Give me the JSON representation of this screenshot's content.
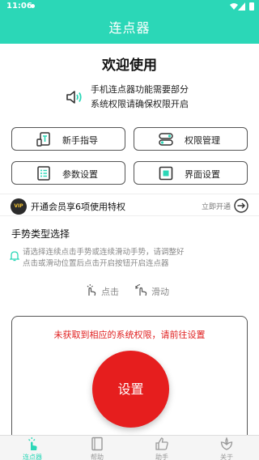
{
  "status_bar": {
    "time": "11:06"
  },
  "app_bar": {
    "title": "连点器"
  },
  "welcome": "欢迎使用",
  "notice": {
    "line1": "手机连点器功能需要部分",
    "line2": "系统权限请确保权限开启"
  },
  "buttons": {
    "guide": "新手指导",
    "permission": "权限管理",
    "params": "参数设置",
    "ui": "界面设置"
  },
  "vip": {
    "badge": "VIP",
    "text": "开通会员享6项使用特权",
    "action": "立即开通"
  },
  "gesture_section": {
    "title": "手势类型选择",
    "hint_line1": "请选择连续点击手势或连续滑动手势，请调整好",
    "hint_line2": "点击或滑动位置后点击开启按钮开启连点器",
    "click_label": "点击",
    "swipe_label": "滑动"
  },
  "panel": {
    "warning": "未获取到相应的系统权限，请前往设置",
    "settings_button": "设置"
  },
  "tabs": [
    {
      "label": "连点器"
    },
    {
      "label": "帮助"
    },
    {
      "label": "助手"
    },
    {
      "label": "关于"
    }
  ],
  "colors": {
    "accent": "#2bd7b7",
    "danger": "#e61e1e",
    "warning_text": "#e02020"
  }
}
